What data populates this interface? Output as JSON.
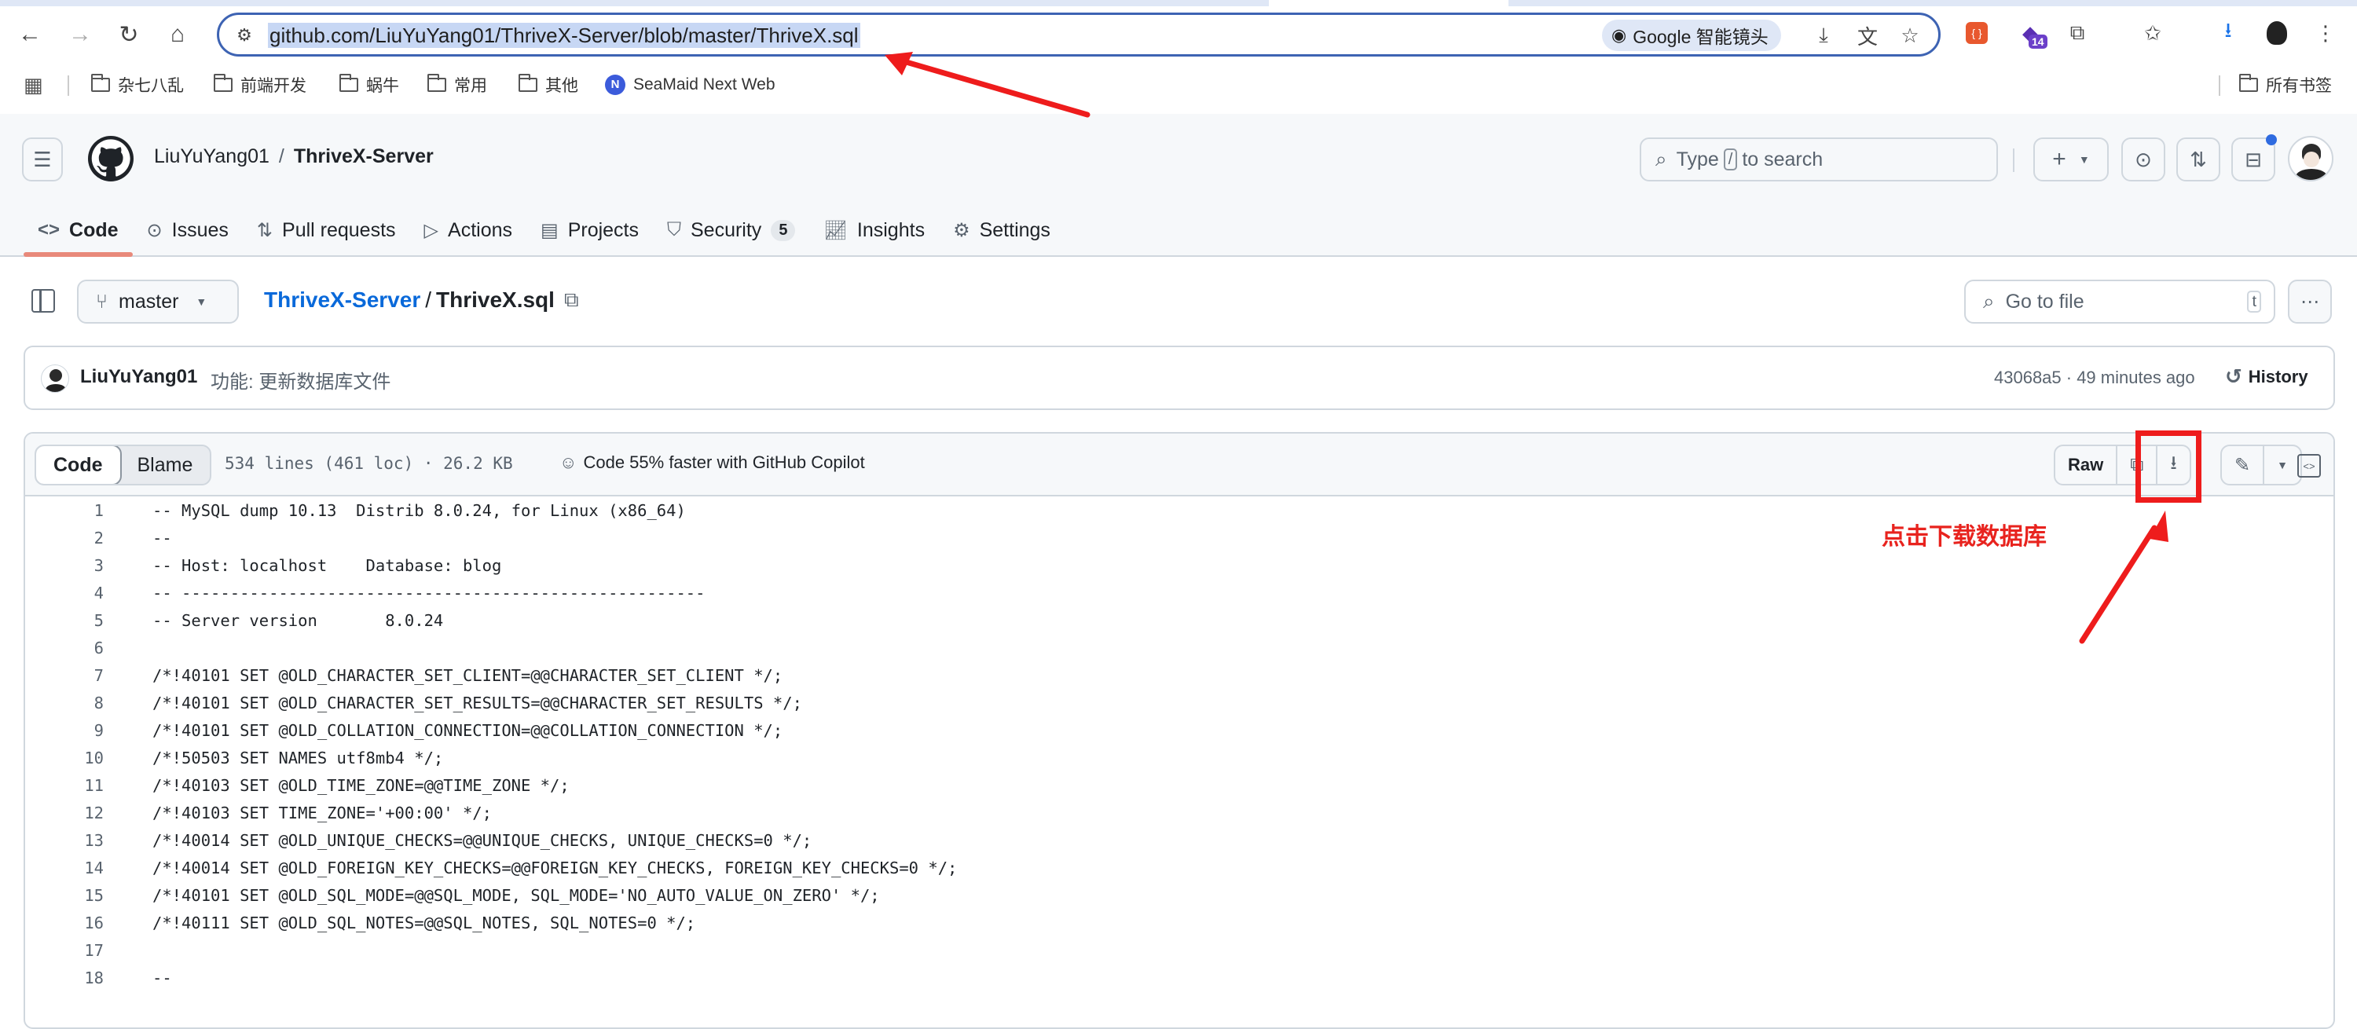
{
  "browser": {
    "url": "github.com/LiuYuYang01/ThriveX-Server/blob/master/ThriveX.sql",
    "lens_label": "Google 智能镜头",
    "extension_badge": "14",
    "bookmarks": [
      "杂七八乱",
      "前端开发",
      "蜗牛",
      "常用",
      "其他",
      "SeaMaid Next Web"
    ],
    "all_bookmarks_label": "所有书签"
  },
  "header": {
    "owner": "LiuYuYang01",
    "separator": "/",
    "repo": "ThriveX-Server",
    "search_prefix": "Type",
    "search_key": "/",
    "search_suffix": "to search",
    "create_plus": "+"
  },
  "tabs": [
    {
      "label": "Code",
      "icon": "code-icon"
    },
    {
      "label": "Issues",
      "icon": "issue-icon"
    },
    {
      "label": "Pull requests",
      "icon": "pull-request-icon"
    },
    {
      "label": "Actions",
      "icon": "play-icon"
    },
    {
      "label": "Projects",
      "icon": "table-icon"
    },
    {
      "label": "Security",
      "icon": "shield-icon",
      "counter": "5"
    },
    {
      "label": "Insights",
      "icon": "graph-icon"
    },
    {
      "label": "Settings",
      "icon": "gear-icon"
    }
  ],
  "file": {
    "branch": "master",
    "repo_link": "ThriveX-Server",
    "sep": "/",
    "filename": "ThriveX.sql",
    "goto_placeholder": "Go to file",
    "goto_key": "t"
  },
  "commit": {
    "author": "LiuYuYang01",
    "message": "功能: 更新数据库文件",
    "sha_time": "43068a5 · 49 minutes ago",
    "history_label": "History"
  },
  "viewer": {
    "code_tab": "Code",
    "blame_tab": "Blame",
    "meta": "534 lines (461 loc) · 26.2 KB",
    "copilot": "Code 55% faster with GitHub Copilot",
    "raw_label": "Raw"
  },
  "code_lines": [
    "-- MySQL dump 10.13  Distrib 8.0.24, for Linux (x86_64)",
    "--",
    "-- Host: localhost    Database: blog",
    "-- ------------------------------------------------------",
    "-- Server version\t8.0.24",
    "",
    "/*!40101 SET @OLD_CHARACTER_SET_CLIENT=@@CHARACTER_SET_CLIENT */;",
    "/*!40101 SET @OLD_CHARACTER_SET_RESULTS=@@CHARACTER_SET_RESULTS */;",
    "/*!40101 SET @OLD_COLLATION_CONNECTION=@@COLLATION_CONNECTION */;",
    "/*!50503 SET NAMES utf8mb4 */;",
    "/*!40103 SET @OLD_TIME_ZONE=@@TIME_ZONE */;",
    "/*!40103 SET TIME_ZONE='+00:00' */;",
    "/*!40014 SET @OLD_UNIQUE_CHECKS=@@UNIQUE_CHECKS, UNIQUE_CHECKS=0 */;",
    "/*!40014 SET @OLD_FOREIGN_KEY_CHECKS=@@FOREIGN_KEY_CHECKS, FOREIGN_KEY_CHECKS=0 */;",
    "/*!40101 SET @OLD_SQL_MODE=@@SQL_MODE, SQL_MODE='NO_AUTO_VALUE_ON_ZERO' */;",
    "/*!40111 SET @OLD_SQL_NOTES=@@SQL_NOTES, SQL_NOTES=0 */;",
    "",
    "--"
  ],
  "annotation": {
    "text": "点击下载数据库",
    "color": "#e8231e"
  }
}
